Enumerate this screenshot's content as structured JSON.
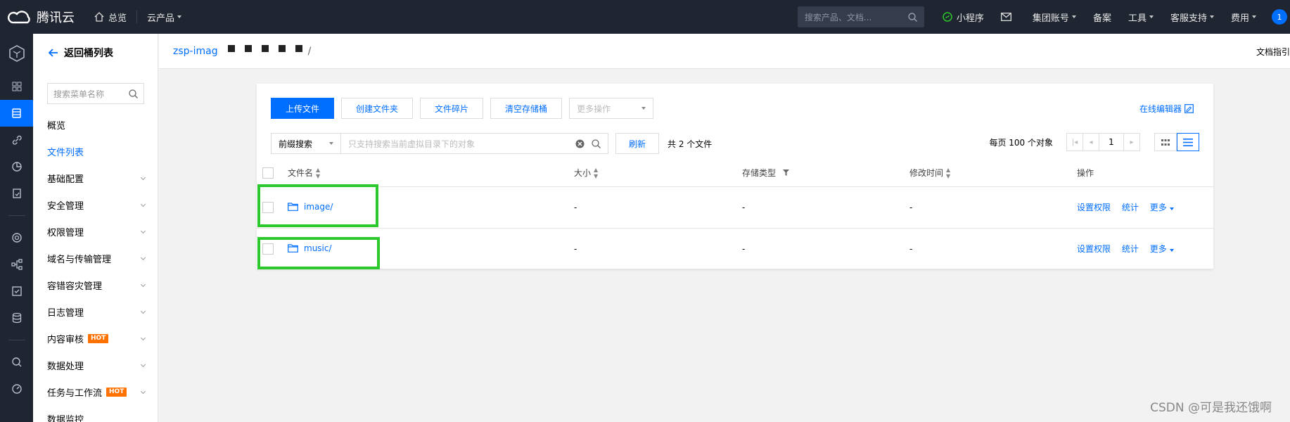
{
  "topbar": {
    "brand": "腾讯云",
    "overview": "总览",
    "products": "云产品",
    "search_placeholder": "搜索产品、文档...",
    "mini_program": "小程序",
    "group_account": "集团账号",
    "filing": "备案",
    "tools": "工具",
    "support": "客服支持",
    "billing": "费用",
    "avatar_text": "1"
  },
  "sidebar": {
    "back_label": "返回桶列表",
    "search_placeholder": "搜索菜单名称",
    "items": [
      {
        "label": "概览"
      },
      {
        "label": "文件列表"
      },
      {
        "label": "基础配置"
      },
      {
        "label": "安全管理"
      },
      {
        "label": "权限管理"
      },
      {
        "label": "域名与传输管理"
      },
      {
        "label": "容错容灾管理"
      },
      {
        "label": "日志管理"
      },
      {
        "label": "内容审核",
        "badge": "HOT"
      },
      {
        "label": "数据处理"
      },
      {
        "label": "任务与工作流",
        "badge": "HOT"
      },
      {
        "label": "数据监控"
      }
    ]
  },
  "breadcrumb": {
    "bucket": "zsp-imag",
    "slash": "/",
    "docs": "文档指引"
  },
  "toolbar": {
    "upload": "上传文件",
    "create_folder": "创建文件夹",
    "fragments": "文件碎片",
    "clear_bucket": "清空存储桶",
    "more_ops": "更多操作",
    "online_editor": "在线编辑器"
  },
  "search": {
    "mode": "前缀搜索",
    "placeholder": "只支持搜索当前虚拟目录下的对象",
    "refresh": "刷新",
    "count": "共 2 个文件"
  },
  "pager": {
    "per_page": "每页 100 个对象",
    "page": "1"
  },
  "table": {
    "headers": {
      "name": "文件名",
      "size": "大小",
      "storage": "存储类型",
      "modified": "修改时间",
      "actions": "操作"
    },
    "rows": [
      {
        "name": "image/",
        "size": "-",
        "storage": "-",
        "modified": "-",
        "act1": "设置权限",
        "act2": "统计",
        "act3": "更多"
      },
      {
        "name": "music/",
        "size": "-",
        "storage": "-",
        "modified": "-",
        "act1": "设置权限",
        "act2": "统计",
        "act3": "更多"
      }
    ]
  },
  "watermark": "CSDN @可是我还饿啊",
  "colors": {
    "accent": "#006eff",
    "highlight": "#2bc92b",
    "topbar": "#1f2531",
    "hot": "#ff7200"
  }
}
